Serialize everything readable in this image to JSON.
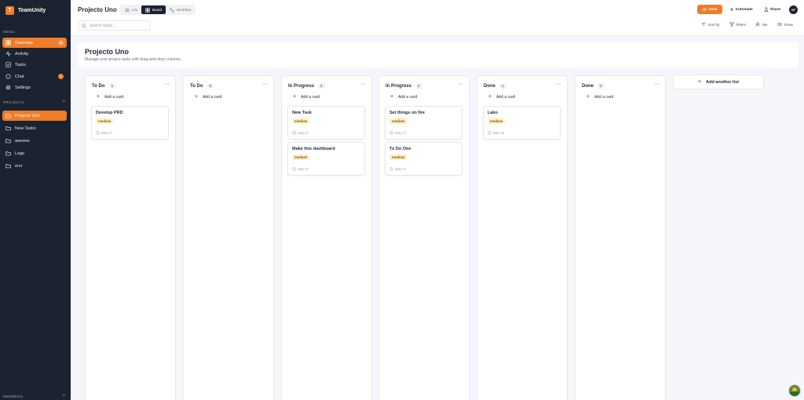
{
  "brand": {
    "logo_letter": "T",
    "name": "TeamUnity"
  },
  "sidebar": {
    "menu_label": "MENU",
    "menu": [
      {
        "label": "Overview",
        "icon": "grid-icon",
        "badge": "8",
        "active": true
      },
      {
        "label": "Activity",
        "icon": "activity-icon",
        "badge": "",
        "active": false
      },
      {
        "label": "Tasks",
        "icon": "checkbox-icon",
        "badge": "",
        "active": false
      },
      {
        "label": "Chat",
        "icon": "chat-icon",
        "badge": "1",
        "active": false
      },
      {
        "label": "Settings",
        "icon": "gear-icon",
        "badge": "",
        "active": false
      }
    ],
    "projects_label": "PROJECTS",
    "projects": [
      {
        "label": "Projecto Uno",
        "active": true
      },
      {
        "label": "New Tasks",
        "active": false
      },
      {
        "label": "awrwrw",
        "active": false
      },
      {
        "label": "Lego",
        "active": false
      },
      {
        "label": "ersr",
        "active": false
      }
    ],
    "members_label": "MEMBERS",
    "plus": "+"
  },
  "topbar": {
    "title": "Projecto Uno",
    "tabs": [
      {
        "label": "List",
        "active": false
      },
      {
        "label": "Board",
        "active": true
      },
      {
        "label": "Workflow",
        "active": false
      }
    ],
    "actions": {
      "view": "View",
      "automate": "Automate",
      "share": "Share",
      "avatar": "SF"
    },
    "search_placeholder": "Search tasks...",
    "filters": {
      "sort": "Sort by",
      "filters": "Filters",
      "me": "Me",
      "show": "Show"
    }
  },
  "board": {
    "title": "Projecto Uno",
    "subtitle": "Manage your project tasks with drag-and-drop columns",
    "add_card_label": "Add a card",
    "add_list_label": "Add another list",
    "columns": [
      {
        "title": "To Do",
        "count": "1",
        "cards": [
          {
            "title": "Develop PRD",
            "tag": "medium",
            "date": "May 27"
          }
        ]
      },
      {
        "title": "To Do",
        "count": "0",
        "cards": []
      },
      {
        "title": "In Progress",
        "count": "2",
        "cards": [
          {
            "title": "New Task",
            "tag": "medium",
            "date": "May 27"
          },
          {
            "title": "Make this dashboard",
            "tag": "medium",
            "date": "May 27"
          }
        ]
      },
      {
        "title": "In Progress",
        "count": "2",
        "cards": [
          {
            "title": "Set things on fire",
            "tag": "medium",
            "date": "May 27"
          },
          {
            "title": "To Do One",
            "tag": "medium",
            "date": "May 27"
          }
        ]
      },
      {
        "title": "Done",
        "count": "1",
        "cards": [
          {
            "title": "Lako",
            "tag": "medium",
            "date": "May 25"
          }
        ]
      },
      {
        "title": "Done",
        "count": "0",
        "cards": []
      }
    ]
  },
  "colors": {
    "accent": "#f07c28",
    "sidebar": "#1b2230",
    "tag_bg": "#fdf1c7"
  }
}
